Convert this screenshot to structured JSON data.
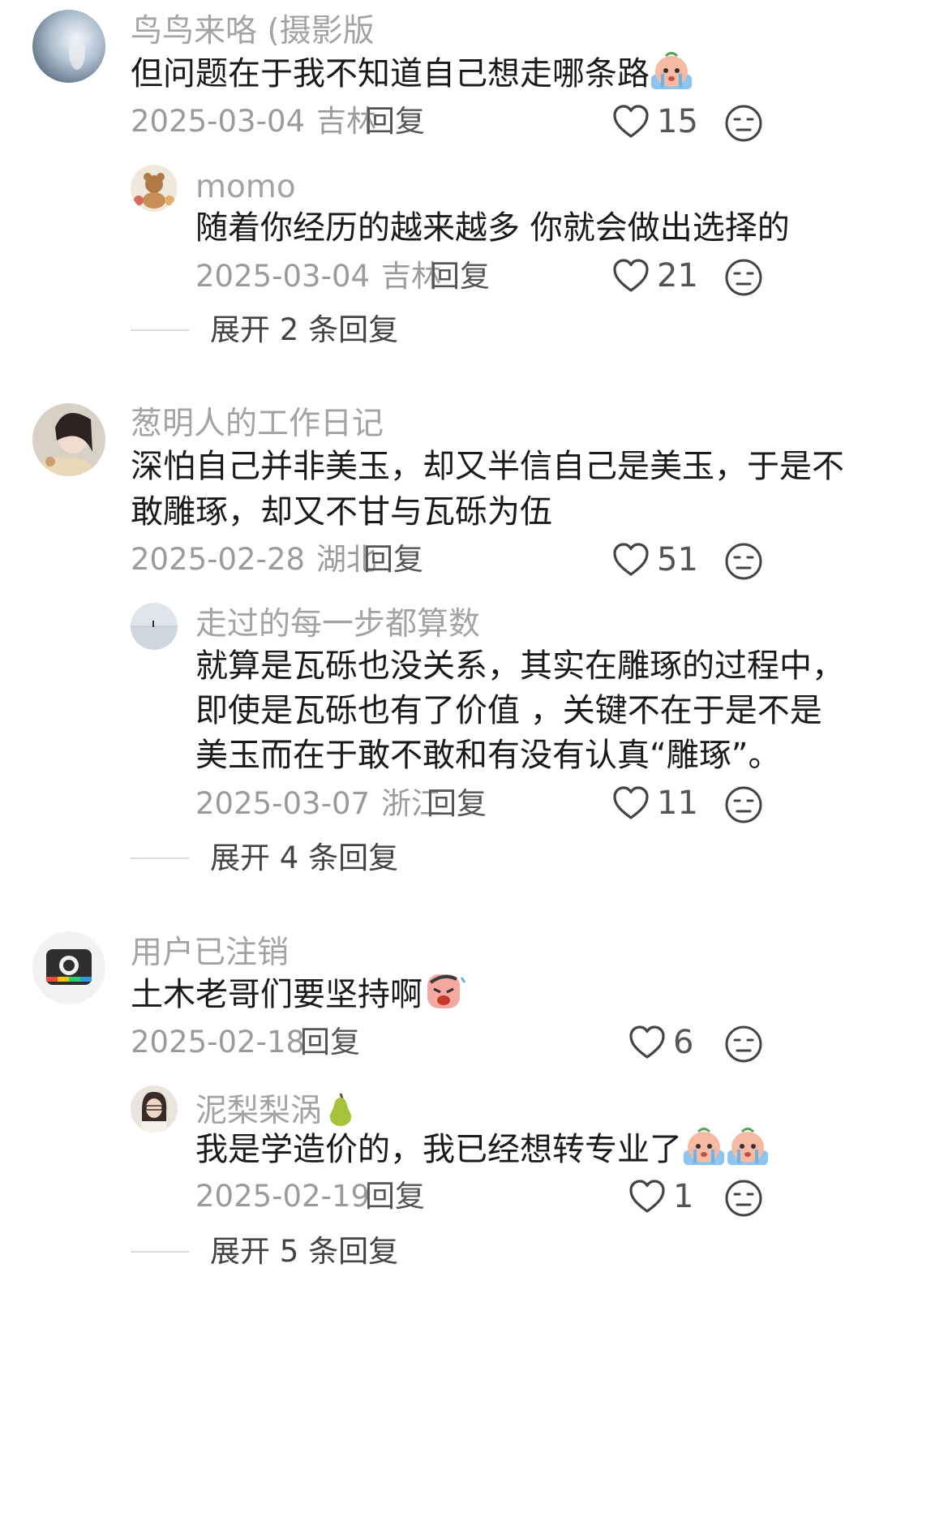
{
  "comments": [
    {
      "user": "鸟鸟来咯 (摄影版",
      "text": "但问题在于我不知道自己想走哪条路",
      "date": "2025-03-04",
      "location": "吉林",
      "reply_label": "回复",
      "likes": "15",
      "emoji": "crying-face-emoji",
      "reply": {
        "user": "momo",
        "text": "随着你经历的越来越多 你就会做出选择的",
        "date": "2025-03-04",
        "location": "吉林",
        "reply_label": "回复",
        "likes": "21"
      },
      "expand_label": "展开 2 条回复"
    },
    {
      "user": "葱明人的工作日记",
      "text_lines": [
        "深怕自己并非美玉，却又半信自己是美玉，于是不",
        "敢雕琢，却又不甘与瓦砾为伍"
      ],
      "date": "2025-02-28",
      "location": "湖北",
      "reply_label": "回复",
      "likes": "51",
      "reply": {
        "user": "走过的每一步都算数",
        "text_lines": [
          "就算是瓦砾也没关系，其实在雕琢的过程中，",
          "即使是瓦砾也有了价值 ，关键不在于是不是",
          "美玉而在于敢不敢和有没有认真“雕琢”。"
        ],
        "date": "2025-03-07",
        "location": "浙江",
        "reply_label": "回复",
        "likes": "11"
      },
      "expand_label": "展开 4 条回复"
    },
    {
      "user": "用户已注销",
      "text": "土木老哥们要坚持啊",
      "emoji": "sobbing-face-emoji",
      "date": "2025-02-18",
      "location": "",
      "reply_label": "回复",
      "likes": "6",
      "reply": {
        "user": "泥梨梨涡",
        "user_emoji": "pear-emoji",
        "text": "我是学造价的，我已经想转专业了",
        "emoji": "crying-face-emoji",
        "date": "2025-02-19",
        "location": "",
        "reply_label": "回复",
        "likes": "1"
      },
      "expand_label": "展开 5 条回复"
    }
  ],
  "colors": {
    "username": "#a3a3a3",
    "body_text": "#1a1a1a",
    "meta": "#9b9b9b",
    "icon_stroke": "#444444"
  }
}
